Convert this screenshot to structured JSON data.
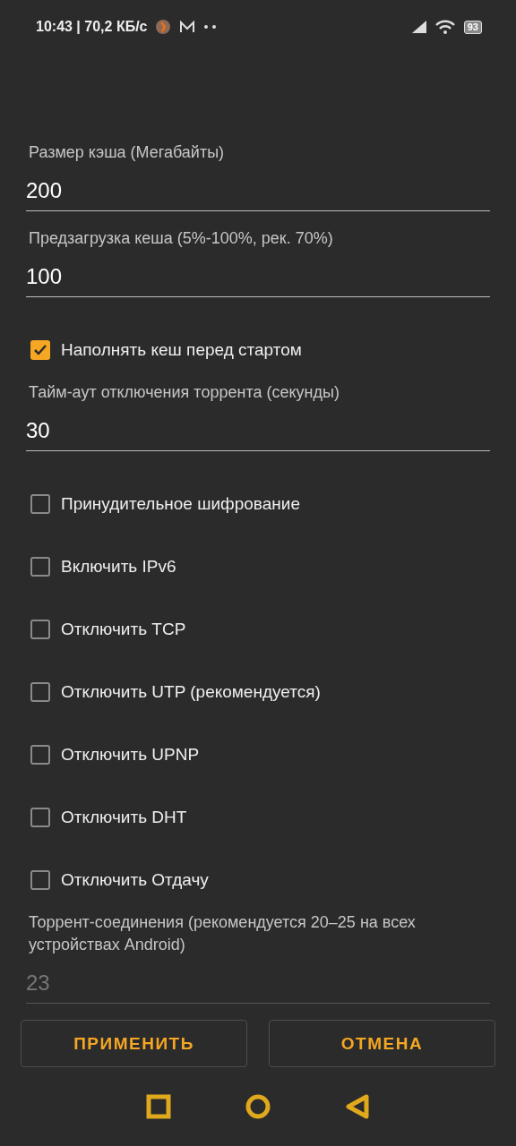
{
  "status_bar": {
    "time": "10:43 | 70,2 КБ/с",
    "battery": "93"
  },
  "settings": [
    {
      "kind": "field",
      "label": "Размер кэша (Мегабайты)",
      "value": "200",
      "disabled": false
    },
    {
      "kind": "field",
      "label": "Предзагрузка кеша (5%-100%, рек. 70%)",
      "value": "100",
      "disabled": false
    },
    {
      "kind": "checkbox",
      "label": "Наполнять кеш перед стартом",
      "checked": true
    },
    {
      "kind": "field",
      "label": "Тайм-аут отключения торрента (секунды)",
      "value": "30",
      "disabled": false
    },
    {
      "kind": "checkbox",
      "label": "Принудительное шифрование",
      "checked": false
    },
    {
      "kind": "checkbox",
      "label": "Включить IPv6",
      "checked": false
    },
    {
      "kind": "checkbox",
      "label": "Отключить TCP",
      "checked": false
    },
    {
      "kind": "checkbox",
      "label": "Отключить UTP (рекомендуется)",
      "checked": false
    },
    {
      "kind": "checkbox",
      "label": "Отключить UPNP",
      "checked": false
    },
    {
      "kind": "checkbox",
      "label": "Отключить DHT",
      "checked": false
    },
    {
      "kind": "checkbox",
      "label": "Отключить Отдачу",
      "checked": false
    },
    {
      "kind": "field",
      "label": "Торрент-соединения (рекомендуется 20–25 на всех устройствах Android)",
      "value": "23",
      "disabled": true
    }
  ],
  "buttons": [
    "ПРИМЕНИТЬ",
    "ОТМЕНА"
  ]
}
